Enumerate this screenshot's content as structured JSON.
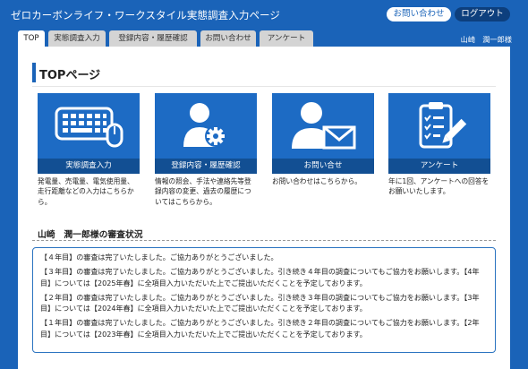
{
  "header": {
    "title": "ゼロカーボンライフ・ワークスタイル実態調査入力ページ",
    "contact_button": "お問い合わせ",
    "logout_button": "ログアウト"
  },
  "tabs": [
    {
      "label": "TOP",
      "active": true
    },
    {
      "label": "実態調査入力",
      "active": false
    },
    {
      "label": "登録内容・履歴確認",
      "active": false
    },
    {
      "label": "お問い合わせ",
      "active": false
    },
    {
      "label": "アンケート",
      "active": false
    }
  ],
  "user": {
    "name": "山崎　潤一郎様"
  },
  "page_title": "TOPページ",
  "cards": [
    {
      "label": "実態調査入力",
      "icon": "keyboard-mouse-icon",
      "description": "発電量、売電量、電気使用量、走行距離などの入力はこちらから。"
    },
    {
      "label": "登録内容・履歴確認",
      "icon": "user-settings-icon",
      "description": "情報の照会、手法や連絡先等登録内容の変更、過去の履歴についてはこちらから。"
    },
    {
      "label": "お問い合せ",
      "icon": "user-mail-icon",
      "description": "お問い合わせはこちらから。"
    },
    {
      "label": "アンケート",
      "icon": "clipboard-pen-icon",
      "description": "年に1回、アンケートへの回答をお願いいたします。"
    }
  ],
  "status": {
    "title": "山崎　潤一郎様の審査状況",
    "items": [
      "【４年目】の審査は完了いたしました。ご協力ありがとうございました。",
      "【３年目】の審査は完了いたしました。ご協力ありがとうございました。引き続き４年目の調査についてもご協力をお願いします。【4年目】については【2025年春】に全項目入力いただいた上でご提出いただくことを予定しております。",
      "【２年目】の審査は完了いたしました。ご協力ありがとうございました。引き続き３年目の調査についてもご協力をお願いします。【3年目】については【2024年春】に全項目入力いただいた上でご提出いただくことを予定しております。",
      "【１年目】の審査は完了いたしました。ご協力ありがとうございました。引き続き２年目の調査についてもご協力をお願いします。【2年目】については【2023年春】に全項目入力いただいた上でご提出いただくことを予定しております。"
    ]
  },
  "colors": {
    "brand": "#1a63b8",
    "card": "#1d6bc4",
    "card_label": "#124f93",
    "logout": "#0d3f7d"
  }
}
